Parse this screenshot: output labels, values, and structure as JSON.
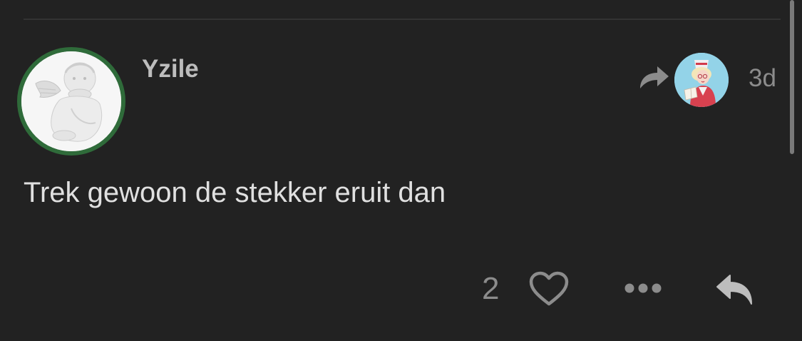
{
  "post": {
    "username": "Yzile",
    "timestamp": "3d",
    "body": "Trek gewoon de stekker eruit dan",
    "like_count": "2"
  },
  "icons": {
    "share": "share-arrow-icon",
    "like": "heart-icon",
    "more": "ellipsis-icon",
    "reply": "reply-arrow-icon"
  },
  "colors": {
    "background": "#222222",
    "avatar_ring": "#2f6b3a",
    "muted_text": "#8c8c8c",
    "body_text": "#e0e0e0"
  }
}
